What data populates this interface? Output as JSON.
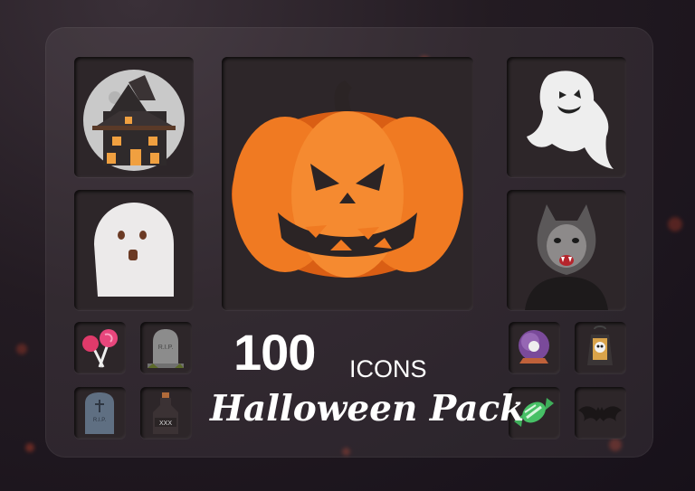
{
  "hero": {
    "count": "100",
    "unit": "ICONS",
    "title": "Halloween Pack"
  },
  "tiles": [
    {
      "icon": "haunted-house-icon"
    },
    {
      "icon": "jack-o-lantern-icon"
    },
    {
      "icon": "flying-ghost-icon"
    },
    {
      "icon": "sheet-ghost-icon"
    },
    {
      "icon": "werewolf-icon"
    },
    {
      "icon": "lollipops-icon"
    },
    {
      "icon": "rip-tombstone-icon"
    },
    {
      "icon": "crystal-ball-icon"
    },
    {
      "icon": "skull-lantern-icon"
    },
    {
      "icon": "cross-tombstone-icon"
    },
    {
      "icon": "poison-bottle-icon"
    },
    {
      "icon": "wrapped-candy-icon"
    },
    {
      "icon": "bat-icon"
    }
  ],
  "tile_text": {
    "rip_small": "R.I.P.",
    "rip_cross": "R.I.P.",
    "bottle_label": "XXX"
  },
  "colors": {
    "pumpkin": "#f07a22",
    "background": "#1c151b",
    "tile": "#2d2629",
    "accent_ember": "#c2412a"
  }
}
